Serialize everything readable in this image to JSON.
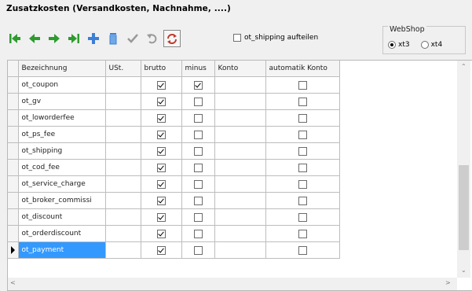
{
  "panel": {
    "title": "Zusatzkosten (Versandkosten, Nachnahme, ....)"
  },
  "toolbar": {
    "buttons": [
      {
        "icon": "first-record-icon",
        "color": "#2e9b2e"
      },
      {
        "icon": "prev-record-icon",
        "color": "#2e9b2e"
      },
      {
        "icon": "next-record-icon",
        "color": "#2e9b2e"
      },
      {
        "icon": "last-record-icon",
        "color": "#2e9b2e"
      },
      {
        "icon": "insert-record-icon",
        "color": "#3b7fd6"
      },
      {
        "icon": "delete-record-icon",
        "color": "#3b7fd6"
      },
      {
        "icon": "post-checkmark-icon",
        "color": "#9a9a9a"
      },
      {
        "icon": "cancel-undo-icon",
        "color": "#9a9a9a"
      },
      {
        "icon": "refresh-icon",
        "color": "#c0392b"
      }
    ],
    "split_shipping_label": "ot_shipping aufteilen",
    "split_shipping_checked": false
  },
  "webshop": {
    "title": "WebShop",
    "options": [
      {
        "label": "xt3",
        "selected": true
      },
      {
        "label": "xt4",
        "selected": false
      }
    ]
  },
  "table": {
    "columns": [
      "Bezeichnung",
      "USt.",
      "brutto",
      "minus",
      "Konto",
      "automatik Konto"
    ],
    "rows": [
      {
        "name": "ot_coupon",
        "ust": "",
        "brutto": true,
        "minus": true,
        "konto": "",
        "auto": false
      },
      {
        "name": "ot_gv",
        "ust": "",
        "brutto": true,
        "minus": false,
        "konto": "",
        "auto": false
      },
      {
        "name": "ot_loworderfee",
        "ust": "",
        "brutto": true,
        "minus": false,
        "konto": "",
        "auto": false
      },
      {
        "name": "ot_ps_fee",
        "ust": "",
        "brutto": true,
        "minus": false,
        "konto": "",
        "auto": false
      },
      {
        "name": "ot_shipping",
        "ust": "",
        "brutto": true,
        "minus": false,
        "konto": "",
        "auto": false
      },
      {
        "name": "ot_cod_fee",
        "ust": "",
        "brutto": true,
        "minus": false,
        "konto": "",
        "auto": false
      },
      {
        "name": "ot_service_charge",
        "ust": "",
        "brutto": true,
        "minus": false,
        "konto": "",
        "auto": false
      },
      {
        "name": "ot_broker_commissi",
        "ust": "",
        "brutto": true,
        "minus": false,
        "konto": "",
        "auto": false
      },
      {
        "name": "ot_discount",
        "ust": "",
        "brutto": true,
        "minus": false,
        "konto": "",
        "auto": false
      },
      {
        "name": "ot_orderdiscount",
        "ust": "",
        "brutto": true,
        "minus": false,
        "konto": "",
        "auto": false
      },
      {
        "name": "ot_payment",
        "ust": "",
        "brutto": true,
        "minus": false,
        "konto": "",
        "auto": false
      }
    ],
    "selected_row": 10
  }
}
